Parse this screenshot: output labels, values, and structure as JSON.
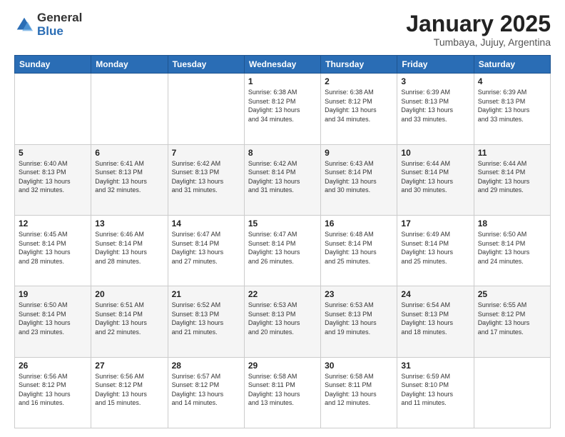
{
  "logo": {
    "general": "General",
    "blue": "Blue"
  },
  "header": {
    "month": "January 2025",
    "location": "Tumbaya, Jujuy, Argentina"
  },
  "weekdays": [
    "Sunday",
    "Monday",
    "Tuesday",
    "Wednesday",
    "Thursday",
    "Friday",
    "Saturday"
  ],
  "weeks": [
    [
      {
        "day": "",
        "info": ""
      },
      {
        "day": "",
        "info": ""
      },
      {
        "day": "",
        "info": ""
      },
      {
        "day": "1",
        "info": "Sunrise: 6:38 AM\nSunset: 8:12 PM\nDaylight: 13 hours\nand 34 minutes."
      },
      {
        "day": "2",
        "info": "Sunrise: 6:38 AM\nSunset: 8:12 PM\nDaylight: 13 hours\nand 34 minutes."
      },
      {
        "day": "3",
        "info": "Sunrise: 6:39 AM\nSunset: 8:13 PM\nDaylight: 13 hours\nand 33 minutes."
      },
      {
        "day": "4",
        "info": "Sunrise: 6:39 AM\nSunset: 8:13 PM\nDaylight: 13 hours\nand 33 minutes."
      }
    ],
    [
      {
        "day": "5",
        "info": "Sunrise: 6:40 AM\nSunset: 8:13 PM\nDaylight: 13 hours\nand 32 minutes."
      },
      {
        "day": "6",
        "info": "Sunrise: 6:41 AM\nSunset: 8:13 PM\nDaylight: 13 hours\nand 32 minutes."
      },
      {
        "day": "7",
        "info": "Sunrise: 6:42 AM\nSunset: 8:13 PM\nDaylight: 13 hours\nand 31 minutes."
      },
      {
        "day": "8",
        "info": "Sunrise: 6:42 AM\nSunset: 8:14 PM\nDaylight: 13 hours\nand 31 minutes."
      },
      {
        "day": "9",
        "info": "Sunrise: 6:43 AM\nSunset: 8:14 PM\nDaylight: 13 hours\nand 30 minutes."
      },
      {
        "day": "10",
        "info": "Sunrise: 6:44 AM\nSunset: 8:14 PM\nDaylight: 13 hours\nand 30 minutes."
      },
      {
        "day": "11",
        "info": "Sunrise: 6:44 AM\nSunset: 8:14 PM\nDaylight: 13 hours\nand 29 minutes."
      }
    ],
    [
      {
        "day": "12",
        "info": "Sunrise: 6:45 AM\nSunset: 8:14 PM\nDaylight: 13 hours\nand 28 minutes."
      },
      {
        "day": "13",
        "info": "Sunrise: 6:46 AM\nSunset: 8:14 PM\nDaylight: 13 hours\nand 28 minutes."
      },
      {
        "day": "14",
        "info": "Sunrise: 6:47 AM\nSunset: 8:14 PM\nDaylight: 13 hours\nand 27 minutes."
      },
      {
        "day": "15",
        "info": "Sunrise: 6:47 AM\nSunset: 8:14 PM\nDaylight: 13 hours\nand 26 minutes."
      },
      {
        "day": "16",
        "info": "Sunrise: 6:48 AM\nSunset: 8:14 PM\nDaylight: 13 hours\nand 25 minutes."
      },
      {
        "day": "17",
        "info": "Sunrise: 6:49 AM\nSunset: 8:14 PM\nDaylight: 13 hours\nand 25 minutes."
      },
      {
        "day": "18",
        "info": "Sunrise: 6:50 AM\nSunset: 8:14 PM\nDaylight: 13 hours\nand 24 minutes."
      }
    ],
    [
      {
        "day": "19",
        "info": "Sunrise: 6:50 AM\nSunset: 8:14 PM\nDaylight: 13 hours\nand 23 minutes."
      },
      {
        "day": "20",
        "info": "Sunrise: 6:51 AM\nSunset: 8:14 PM\nDaylight: 13 hours\nand 22 minutes."
      },
      {
        "day": "21",
        "info": "Sunrise: 6:52 AM\nSunset: 8:13 PM\nDaylight: 13 hours\nand 21 minutes."
      },
      {
        "day": "22",
        "info": "Sunrise: 6:53 AM\nSunset: 8:13 PM\nDaylight: 13 hours\nand 20 minutes."
      },
      {
        "day": "23",
        "info": "Sunrise: 6:53 AM\nSunset: 8:13 PM\nDaylight: 13 hours\nand 19 minutes."
      },
      {
        "day": "24",
        "info": "Sunrise: 6:54 AM\nSunset: 8:13 PM\nDaylight: 13 hours\nand 18 minutes."
      },
      {
        "day": "25",
        "info": "Sunrise: 6:55 AM\nSunset: 8:12 PM\nDaylight: 13 hours\nand 17 minutes."
      }
    ],
    [
      {
        "day": "26",
        "info": "Sunrise: 6:56 AM\nSunset: 8:12 PM\nDaylight: 13 hours\nand 16 minutes."
      },
      {
        "day": "27",
        "info": "Sunrise: 6:56 AM\nSunset: 8:12 PM\nDaylight: 13 hours\nand 15 minutes."
      },
      {
        "day": "28",
        "info": "Sunrise: 6:57 AM\nSunset: 8:12 PM\nDaylight: 13 hours\nand 14 minutes."
      },
      {
        "day": "29",
        "info": "Sunrise: 6:58 AM\nSunset: 8:11 PM\nDaylight: 13 hours\nand 13 minutes."
      },
      {
        "day": "30",
        "info": "Sunrise: 6:58 AM\nSunset: 8:11 PM\nDaylight: 13 hours\nand 12 minutes."
      },
      {
        "day": "31",
        "info": "Sunrise: 6:59 AM\nSunset: 8:10 PM\nDaylight: 13 hours\nand 11 minutes."
      },
      {
        "day": "",
        "info": ""
      }
    ]
  ]
}
